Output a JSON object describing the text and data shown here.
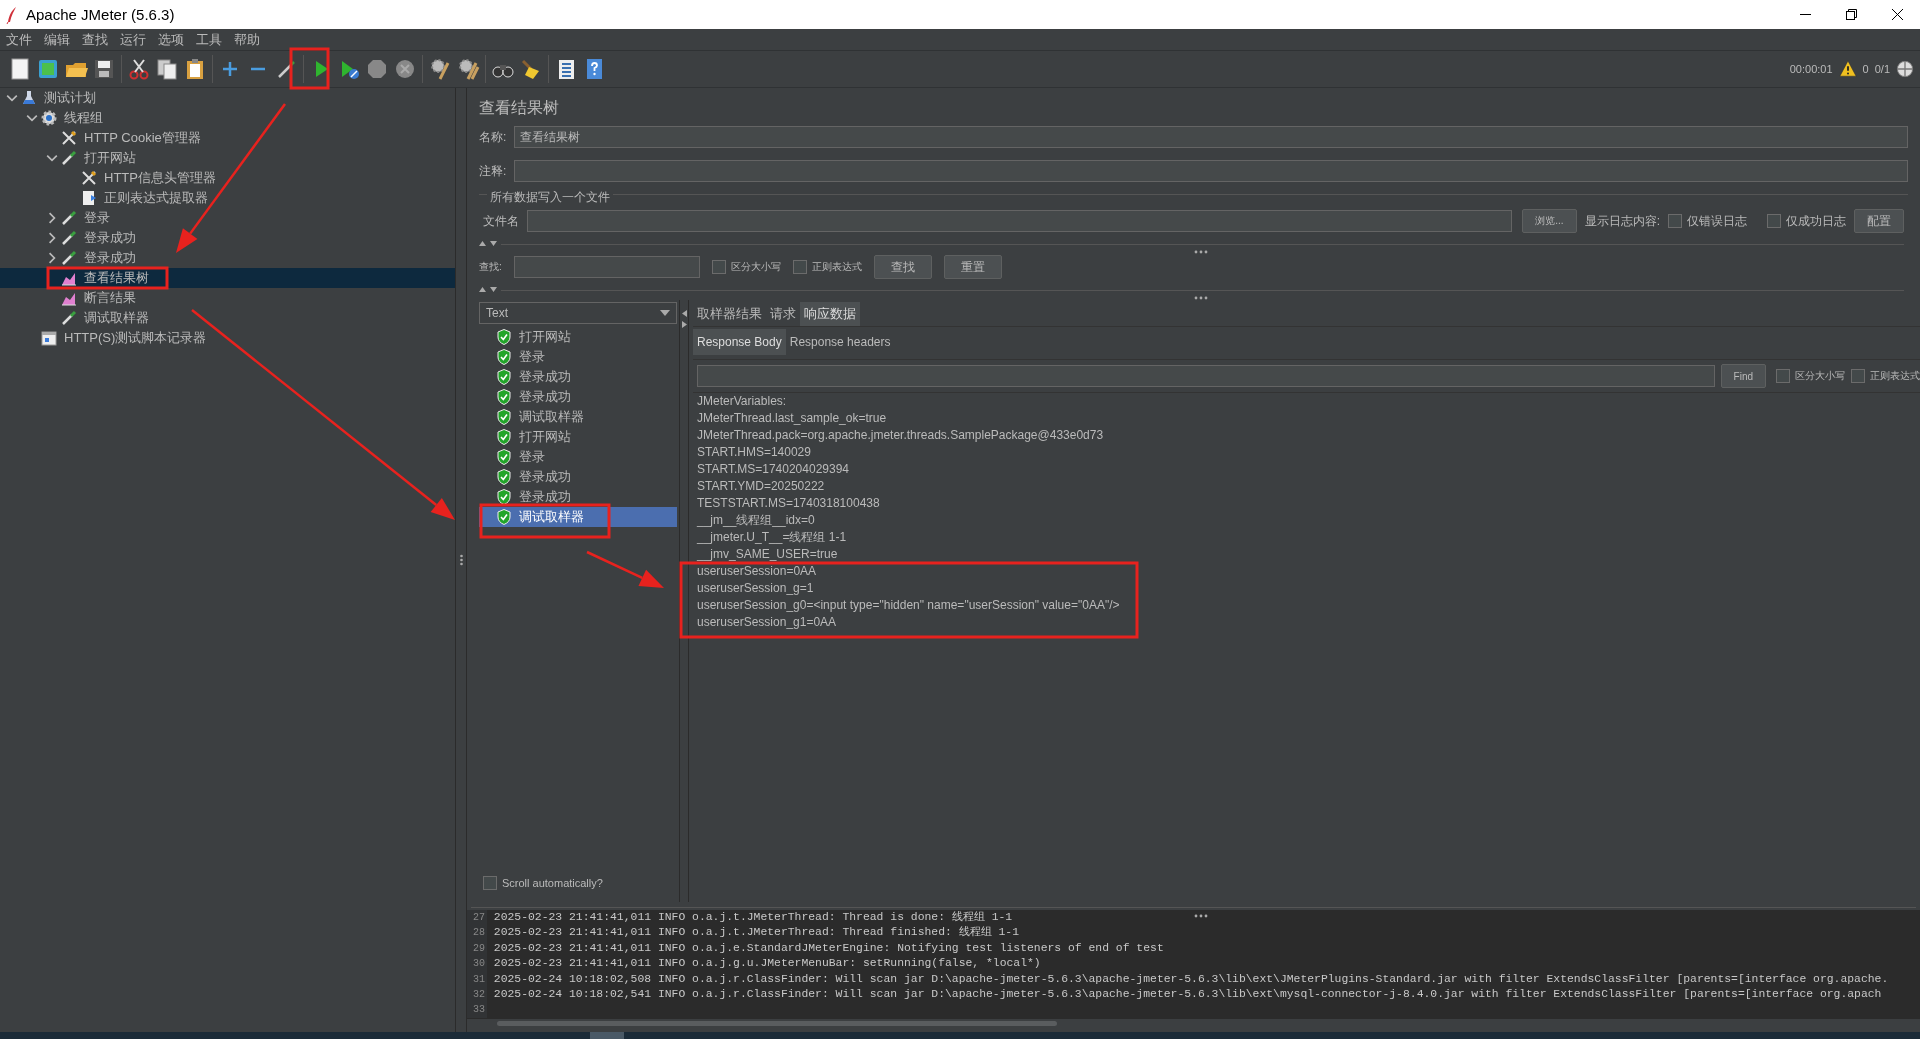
{
  "window": {
    "title": "Apache JMeter (5.6.3)"
  },
  "menu": [
    "文件",
    "编辑",
    "查找",
    "运行",
    "选项",
    "工具",
    "帮助"
  ],
  "status": {
    "elapsed": "00:00:01",
    "warnings": "0",
    "threads": "0/1"
  },
  "tree": [
    {
      "label": "测试计划",
      "kind": "plan",
      "expanded": true,
      "selected": false,
      "children": [
        {
          "label": "线程组",
          "kind": "thread-group",
          "expanded": true,
          "selected": false,
          "children": [
            {
              "label": "HTTP Cookie管理器",
              "kind": "config",
              "selected": false
            },
            {
              "label": "打开网站",
              "kind": "sampler",
              "expanded": true,
              "selected": false,
              "children": [
                {
                  "label": "HTTP信息头管理器",
                  "kind": "config",
                  "selected": false
                },
                {
                  "label": "正则表达式提取器",
                  "kind": "extractor",
                  "selected": false
                }
              ]
            },
            {
              "label": "登录",
              "kind": "sampler",
              "expanded": false,
              "selected": false
            },
            {
              "label": "登录成功",
              "kind": "sampler",
              "expanded": false,
              "selected": false
            },
            {
              "label": "登录成功",
              "kind": "sampler",
              "expanded": false,
              "selected": false
            },
            {
              "label": "查看结果树",
              "kind": "listener",
              "selected": true
            },
            {
              "label": "断言结果",
              "kind": "listener",
              "selected": false
            },
            {
              "label": "调试取样器",
              "kind": "sampler",
              "selected": false
            }
          ]
        },
        {
          "label": "HTTP(S)测试脚本记录器",
          "kind": "recorder",
          "selected": false
        }
      ]
    }
  ],
  "panel": {
    "title": "查看结果树",
    "name": {
      "label": "名称:",
      "value": "查看结果树"
    },
    "comment": {
      "label": "注释:"
    },
    "file_group": {
      "title": "所有数据写入一个文件",
      "file_label": "文件名",
      "browse_button": "浏览...",
      "log_label": "显示日志内容:",
      "checkboxes": [
        {
          "label": "仅错误日志",
          "checked": false
        },
        {
          "label": "仅成功日志",
          "checked": false
        }
      ],
      "config_button": "配置"
    },
    "search": {
      "label": "查找:",
      "checkboxes": [
        {
          "label": "区分大小写",
          "checked": false
        },
        {
          "label": "正则表达式",
          "checked": false
        }
      ],
      "buttons": [
        "查找",
        "重置"
      ]
    }
  },
  "results": {
    "renderer": "Text",
    "items": [
      {
        "label": "打开网站",
        "success": true,
        "selected": false
      },
      {
        "label": "登录",
        "success": true,
        "selected": false
      },
      {
        "label": "登录成功",
        "success": true,
        "selected": false
      },
      {
        "label": "登录成功",
        "success": true,
        "selected": false
      },
      {
        "label": "调试取样器",
        "success": true,
        "selected": false
      },
      {
        "label": "打开网站",
        "success": true,
        "selected": false
      },
      {
        "label": "登录",
        "success": true,
        "selected": false
      },
      {
        "label": "登录成功",
        "success": true,
        "selected": false
      },
      {
        "label": "登录成功",
        "success": true,
        "selected": false
      },
      {
        "label": "调试取样器",
        "success": true,
        "selected": true
      }
    ],
    "scroll_auto": {
      "label": "Scroll automatically?",
      "checked": false
    },
    "tabs": [
      {
        "label": "取样器结果",
        "selected": false
      },
      {
        "label": "请求",
        "selected": false
      },
      {
        "label": "响应数据",
        "selected": true
      }
    ],
    "subtabs": [
      {
        "label": "Response Body",
        "selected": true
      },
      {
        "label": "Response headers",
        "selected": false
      }
    ],
    "find": {
      "button": "Find",
      "checkboxes": [
        {
          "label": "区分大小写",
          "checked": false
        },
        {
          "label": "正则表达式",
          "checked": false
        }
      ]
    },
    "body_lines": [
      "JMeterVariables:",
      "JMeterThread.last_sample_ok=true",
      "JMeterThread.pack=org.apache.jmeter.threads.SamplePackage@433e0d73",
      "START.HMS=140029",
      "START.MS=1740204029394",
      "START.YMD=20250222",
      "TESTSTART.MS=1740318100438",
      "__jm__线程组__idx=0",
      "__jmeter.U_T__=线程组 1-1",
      "__jmv_SAME_USER=true",
      "useruserSession=0AA",
      "useruserSession_g=1",
      "useruserSession_g0=<input type=\"hidden\" name=\"userSession\" value=\"0AA\"/>",
      "useruserSession_g1=0AA"
    ]
  },
  "log": [
    {
      "number": "27",
      "text": "2025-02-23 21:41:41,011 INFO o.a.j.t.JMeterThread: Thread is done: 线程组 1-1"
    },
    {
      "number": "28",
      "text": "2025-02-23 21:41:41,011 INFO o.a.j.t.JMeterThread: Thread finished: 线程组 1-1"
    },
    {
      "number": "29",
      "text": "2025-02-23 21:41:41,011 INFO o.a.j.e.StandardJMeterEngine: Notifying test listeners of end of test"
    },
    {
      "number": "30",
      "text": "2025-02-23 21:41:41,011 INFO o.a.j.g.u.JMeterMenuBar: setRunning(false, *local*)"
    },
    {
      "number": "31",
      "text": "2025-02-24 10:18:02,508 INFO o.a.j.r.ClassFinder: Will scan jar D:\\apache-jmeter-5.6.3\\apache-jmeter-5.6.3\\lib\\ext\\JMeterPlugins-Standard.jar with filter ExtendsClassFilter [parents=[interface org.apache."
    },
    {
      "number": "32",
      "text": "2025-02-24 10:18:02,541 INFO o.a.j.r.ClassFinder: Will scan jar D:\\apache-jmeter-5.6.3\\apache-jmeter-5.6.3\\lib\\ext\\mysql-connector-j-8.4.0.jar with filter ExtendsClassFilter [parents=[interface org.apach"
    },
    {
      "number": "33"
    }
  ]
}
